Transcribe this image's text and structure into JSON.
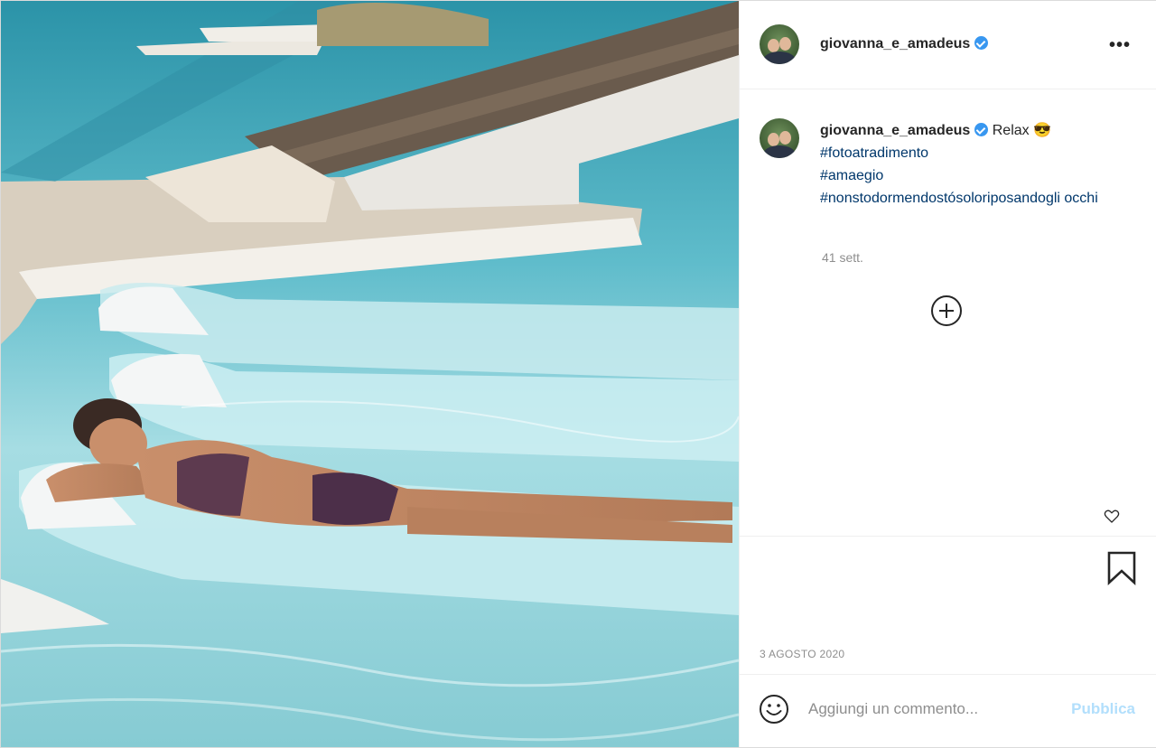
{
  "post": {
    "username": "giovanna_e_amadeus",
    "verified": true,
    "more_icon": "more-horizontal-icon"
  },
  "caption": {
    "username": "giovanna_e_amadeus",
    "text": "Relax 😎",
    "hashtags": [
      "#fotoatradimento",
      "#amaegio",
      "#nonstodormendostósoloriposandogli occhi"
    ],
    "age": "41 sett."
  },
  "date": "3 agosto 2020",
  "comment_box": {
    "placeholder": "Aggiungi un commento...",
    "publish_label": "Pubblica"
  },
  "icons": {
    "load_more": "plus-circle-icon",
    "like": "heart-icon",
    "save": "bookmark-icon",
    "emoji": "smiley-icon"
  },
  "colors": {
    "verified": "#3897f0",
    "hashtag": "#00376b",
    "publish_disabled": "#b2dffc",
    "muted": "#8e8e8e"
  }
}
